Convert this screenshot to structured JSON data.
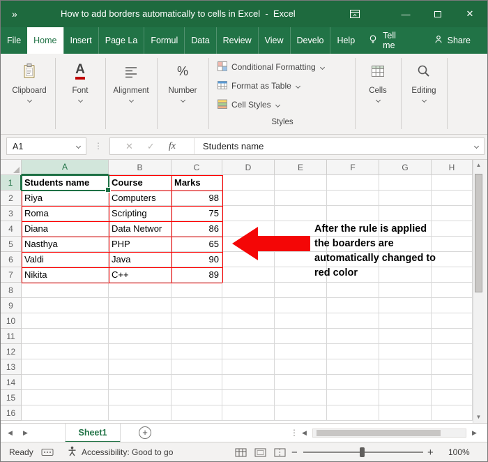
{
  "colors": {
    "excel_green": "#217346",
    "border_red": "#FF0000",
    "arrow_red": "#F40606"
  },
  "title_bar": {
    "overflow_chevrons": "»",
    "title": "How to add borders automatically to cells in Excel  -  Excel"
  },
  "ribbon": {
    "tabs": [
      {
        "label": "File"
      },
      {
        "label": "Home"
      },
      {
        "label": "Insert"
      },
      {
        "label": "Page La"
      },
      {
        "label": "Formul"
      },
      {
        "label": "Data"
      },
      {
        "label": "Review"
      },
      {
        "label": "View"
      },
      {
        "label": "Develo"
      },
      {
        "label": "Help"
      }
    ],
    "active_tab": "Home",
    "tell_me": "Tell me",
    "share": "Share",
    "collapsed_groups": [
      {
        "label": "Clipboard"
      },
      {
        "label": "Font"
      },
      {
        "label": "Alignment"
      },
      {
        "label": "Number"
      }
    ],
    "styles_group": {
      "label": "Styles",
      "buttons": [
        {
          "label": "Conditional Formatting"
        },
        {
          "label": "Format as Table"
        },
        {
          "label": "Cell Styles"
        }
      ]
    },
    "right_groups": [
      {
        "label": "Cells"
      },
      {
        "label": "Editing"
      }
    ]
  },
  "formula_bar": {
    "name_box": "A1",
    "fx_label": "fx",
    "formula": "Students name"
  },
  "grid": {
    "column_headers": [
      "A",
      "B",
      "C",
      "D",
      "E",
      "F",
      "G",
      "H"
    ],
    "row_count": 16,
    "selected_cell": "A1",
    "selected_column": "A",
    "selected_row": 1,
    "red_border_range": "A1:C7",
    "data_rows": [
      [
        "Students name",
        "Course",
        "Marks"
      ],
      [
        "Riya",
        "Computers",
        "98"
      ],
      [
        "Roma",
        "Scripting",
        "75"
      ],
      [
        "Diana",
        "Data Networ",
        "86"
      ],
      [
        "Nasthya",
        "PHP",
        "65"
      ],
      [
        "Valdi",
        "Java",
        "90"
      ],
      [
        "Nikita",
        "C++",
        "89"
      ]
    ]
  },
  "annotation": {
    "text": "After the rule is applied\nthe boarders are\nautomatically changed to\nred color"
  },
  "sheet_bar": {
    "tabs": [
      {
        "label": "Sheet1",
        "active": true
      }
    ]
  },
  "status_bar": {
    "mode": "Ready",
    "accessibility": "Accessibility: Good to go",
    "zoom_level": "100%"
  }
}
